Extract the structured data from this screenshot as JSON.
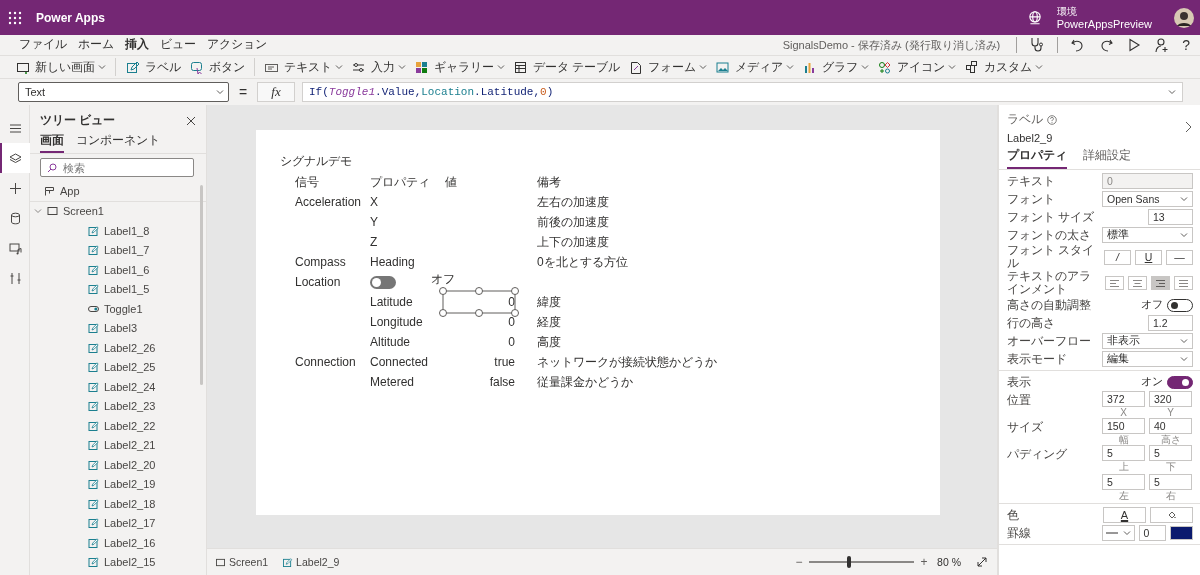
{
  "app_bar": {
    "product": "Power Apps",
    "environment_label": "環境",
    "environment": "PowerAppsPreview"
  },
  "menu": {
    "tabs": [
      {
        "label": "ファイル",
        "selected": false
      },
      {
        "label": "ホーム",
        "selected": false
      },
      {
        "label": "挿入",
        "selected": true
      },
      {
        "label": "ビュー",
        "selected": false
      },
      {
        "label": "アクション",
        "selected": false
      }
    ],
    "document_status": "SignalsDemo - 保存済み (発行取り消し済み)",
    "actions": [
      {
        "kind": "checker"
      },
      {
        "kind": "undo"
      },
      {
        "kind": "redo"
      },
      {
        "kind": "play"
      },
      {
        "kind": "share"
      },
      {
        "kind": "help",
        "glyph": "?"
      }
    ]
  },
  "toolbar": [
    {
      "kind": "screen",
      "label": "新しい画面",
      "dropdown": true
    },
    {
      "kind": "label",
      "label": "ラベル",
      "dropdown": false
    },
    {
      "kind": "button",
      "label": "ボタン",
      "dropdown": false
    },
    {
      "kind": "text",
      "label": "テキスト",
      "dropdown": true
    },
    {
      "kind": "input",
      "label": "入力",
      "dropdown": true
    },
    {
      "kind": "gallery",
      "label": "ギャラリー",
      "dropdown": true
    },
    {
      "kind": "table",
      "label": "データ テーブル",
      "dropdown": false
    },
    {
      "kind": "form",
      "label": "フォーム",
      "dropdown": true
    },
    {
      "kind": "media",
      "label": "メディア",
      "dropdown": true
    },
    {
      "kind": "chart",
      "label": "グラフ",
      "dropdown": true
    },
    {
      "kind": "icons",
      "label": "アイコン",
      "dropdown": true
    },
    {
      "kind": "custom",
      "label": "カスタム",
      "dropdown": true
    }
  ],
  "formula_bar": {
    "property": "Text",
    "equals": "=",
    "fx": "fx",
    "tokens": [
      {
        "kind": "function",
        "text": "If("
      },
      {
        "kind": "control",
        "text": "Toggle1"
      },
      {
        "kind": "plain",
        "text": ".Value,"
      },
      {
        "kind": "signal",
        "text": "Location"
      },
      {
        "kind": "plain",
        "text": ".Latitude,"
      },
      {
        "kind": "number",
        "text": "0"
      },
      {
        "kind": "function",
        "text": ")"
      }
    ]
  },
  "rail": [
    {
      "kind": "menu",
      "selected": false
    },
    {
      "kind": "tree",
      "selected": true
    },
    {
      "kind": "insert",
      "selected": false
    },
    {
      "kind": "data",
      "selected": false
    },
    {
      "kind": "media",
      "selected": false
    },
    {
      "kind": "advanced",
      "selected": false
    }
  ],
  "tree_view": {
    "title": "ツリー ビュー",
    "tabs": [
      {
        "label": "画面",
        "selected": true
      },
      {
        "label": "コンポーネント",
        "selected": false
      }
    ],
    "search": {
      "placeholder": "検索"
    },
    "items": [
      {
        "kind": "app",
        "label": "App"
      },
      {
        "kind": "screen",
        "label": "Screen1",
        "expanded": true,
        "children": [
          {
            "kind": "label",
            "label": "Label1_8"
          },
          {
            "kind": "label",
            "label": "Label1_7"
          },
          {
            "kind": "label",
            "label": "Label1_6"
          },
          {
            "kind": "label",
            "label": "Label1_5"
          },
          {
            "kind": "toggle",
            "label": "Toggle1"
          },
          {
            "kind": "label",
            "label": "Label3"
          },
          {
            "kind": "label",
            "label": "Label2_26"
          },
          {
            "kind": "label",
            "label": "Label2_25"
          },
          {
            "kind": "label",
            "label": "Label2_24"
          },
          {
            "kind": "label",
            "label": "Label2_23"
          },
          {
            "kind": "label",
            "label": "Label2_22"
          },
          {
            "kind": "label",
            "label": "Label2_21"
          },
          {
            "kind": "label",
            "label": "Label2_20"
          },
          {
            "kind": "label",
            "label": "Label2_19"
          },
          {
            "kind": "label",
            "label": "Label2_18"
          },
          {
            "kind": "label",
            "label": "Label2_17"
          },
          {
            "kind": "label",
            "label": "Label2_16"
          },
          {
            "kind": "label",
            "label": "Label2_15"
          }
        ]
      }
    ]
  },
  "canvas": {
    "title": "シグナルデモ",
    "columns": [
      "信号",
      "プロパティ",
      "値",
      "備考"
    ],
    "rows": [
      {
        "kind": "text",
        "signal": "Acceleration",
        "property": "X",
        "note": "左右の加速度",
        "selected": false
      },
      {
        "kind": "text",
        "property": "Y",
        "note": "前後の加速度",
        "selected": false
      },
      {
        "kind": "text",
        "property": "Z",
        "note": "上下の加速度",
        "selected": false
      },
      {
        "kind": "text",
        "signal": "Compass",
        "property": "Heading",
        "note": "0を北とする方位",
        "selected": false
      },
      {
        "kind": "toggle",
        "signal": "Location",
        "on": false,
        "state_label": "オフ",
        "selected": false
      },
      {
        "kind": "text",
        "property": "Latitude",
        "value": "0",
        "note": "緯度",
        "selected": true
      },
      {
        "kind": "text",
        "property": "Longitude",
        "value": "0",
        "note": "経度",
        "selected": false
      },
      {
        "kind": "text",
        "property": "Altitude",
        "value": "0",
        "note": "高度",
        "selected": false
      },
      {
        "kind": "text",
        "signal": "Connection",
        "property": "Connected",
        "value": "true",
        "note": "ネットワークが接続状態かどうか",
        "selected": false
      },
      {
        "kind": "text",
        "property": "Metered",
        "value": "false",
        "note": "従量課金かどうか",
        "selected": false
      }
    ]
  },
  "status_bar": {
    "breadcrumbs": [
      {
        "kind": "screen",
        "label": "Screen1"
      },
      {
        "kind": "label",
        "label": "Label2_9"
      }
    ],
    "zoom_out": "−",
    "zoom_in": "+",
    "zoom": {
      "level": 0.38
    },
    "zoom_text": "80 %"
  },
  "properties": {
    "type": "ラベル",
    "name": "Label2_9",
    "tabs": [
      {
        "label": "プロパティ",
        "selected": true
      },
      {
        "label": "詳細設定",
        "selected": false
      }
    ],
    "sections": [
      [
        {
          "kind": "input",
          "label": "テキスト",
          "value": "0",
          "disabled": true
        },
        {
          "kind": "dropdown",
          "label": "フォント",
          "value": "Open Sans"
        },
        {
          "kind": "number",
          "label": "フォント サイズ",
          "value": "13"
        },
        {
          "kind": "dropdown",
          "label": "フォントの太さ",
          "value": "標準"
        },
        {
          "kind": "style",
          "label": "フォント スタイル",
          "buttons": [
            "/",
            "U",
            "—"
          ]
        },
        {
          "kind": "align",
          "label": "テキストのアラインメント",
          "options": [
            {
              "selected": false
            },
            {
              "selected": false
            },
            {
              "selected": true
            },
            {
              "selected": false
            }
          ]
        },
        {
          "kind": "toggle",
          "label": "高さの自動調整",
          "state_label": "オフ",
          "on": false
        },
        {
          "kind": "number",
          "label": "行の高さ",
          "value": "1.2"
        },
        {
          "kind": "dropdown",
          "label": "オーバーフロー",
          "value": "非表示"
        },
        {
          "kind": "dropdown",
          "label": "表示モード",
          "value": "編集"
        }
      ],
      [
        {
          "kind": "toggle",
          "label": "表示",
          "state_label": "オン",
          "on": true
        },
        {
          "kind": "pair",
          "label": "位置",
          "rows": [
            [
              {
                "value": "372",
                "caption": "X"
              },
              {
                "value": "320",
                "caption": "Y"
              }
            ]
          ]
        },
        {
          "kind": "pair",
          "label": "サイズ",
          "rows": [
            [
              {
                "value": "150",
                "caption": "幅"
              },
              {
                "value": "40",
                "caption": "高さ"
              }
            ]
          ]
        },
        {
          "kind": "pair",
          "label": "パディング",
          "rows": [
            [
              {
                "value": "5",
                "caption": "上"
              },
              {
                "value": "5",
                "caption": "下"
              }
            ],
            [
              {
                "value": "5",
                "caption": "左"
              },
              {
                "value": "5",
                "caption": "右"
              }
            ]
          ]
        }
      ],
      [
        {
          "kind": "color",
          "label": "色",
          "text_button": "A"
        },
        {
          "kind": "border",
          "label": "罫線",
          "value": "0",
          "color": "#0b1a6e"
        }
      ]
    ]
  }
}
